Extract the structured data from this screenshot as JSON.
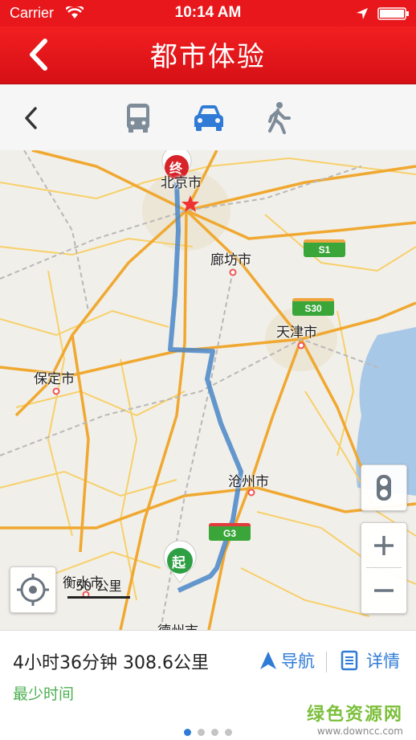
{
  "status_bar": {
    "carrier": "Carrier",
    "time": "10:14 AM"
  },
  "header": {
    "title": "都市体验"
  },
  "transport_modes": [
    {
      "name": "bus",
      "active": false
    },
    {
      "name": "car",
      "active": true
    },
    {
      "name": "walk",
      "active": false
    }
  ],
  "map": {
    "cities": {
      "beijing": "北京市",
      "langfang": "廊坊市",
      "tianjin": "天津市",
      "baoding": "保定市",
      "cangzhou": "沧州市",
      "hengshui": "衡水市",
      "dezhou": "德州市"
    },
    "highways": {
      "s1": "S1",
      "s30": "S30",
      "g3": "G3"
    },
    "markers": {
      "end": "终",
      "start": "起"
    },
    "scale": "50 公里"
  },
  "route": {
    "summary": "4小时36分钟  308.6公里",
    "subtitle": "最少时间",
    "nav_label": "导航",
    "detail_label": "详情"
  },
  "pager": {
    "count": 4,
    "active_index": 0
  },
  "watermark": {
    "line1": "绿色资源网",
    "line2": "www.downcc.com"
  },
  "colors": {
    "header_red": "#e8171c",
    "accent_blue": "#2f7bd6",
    "route_blue": "#4a86c8",
    "subtitle_green": "#4caf50"
  }
}
